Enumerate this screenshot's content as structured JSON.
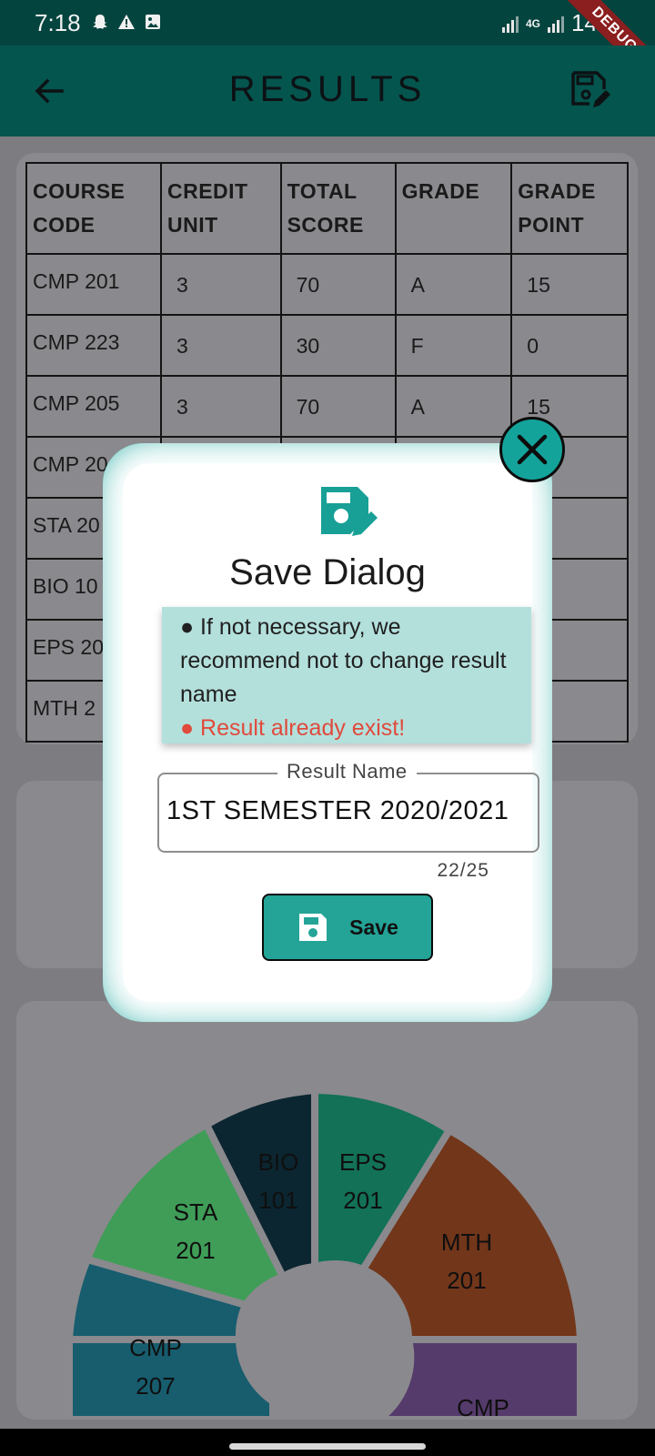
{
  "status_bar": {
    "time": "7:18",
    "network": "4G",
    "battery": "14%",
    "icons": [
      "snapchat-icon",
      "warning-icon",
      "image-icon"
    ]
  },
  "debug_banner": "DEBUG",
  "app_bar": {
    "title": "RESULTS",
    "back_icon": "arrow-left-icon",
    "action_icon": "save-edit-icon"
  },
  "table": {
    "headers": [
      [
        "COURSE",
        "CODE"
      ],
      [
        "CREDIT",
        "UNIT"
      ],
      [
        "TOTAL",
        "SCORE"
      ],
      [
        "GRADE",
        ""
      ],
      [
        "GRADE",
        "POINT"
      ]
    ],
    "rows": [
      [
        "CMP 201",
        "3",
        "70",
        "A",
        "15"
      ],
      [
        "CMP 223",
        "3",
        "30",
        "F",
        "0"
      ],
      [
        "CMP 205",
        "3",
        "70",
        "A",
        "15"
      ],
      [
        "CMP 20",
        "",
        "",
        "",
        ""
      ],
      [
        "STA 20",
        "",
        "",
        "",
        ""
      ],
      [
        "BIO 10",
        "",
        "",
        "",
        ""
      ],
      [
        "EPS 20",
        "",
        "",
        "",
        ""
      ],
      [
        "MTH 2",
        "",
        "",
        "",
        ""
      ]
    ]
  },
  "pie": {
    "slices": [
      {
        "line1": "BIO",
        "line2": "101",
        "color": "#0b2631"
      },
      {
        "line1": "EPS",
        "line2": "201",
        "color": "#127157"
      },
      {
        "line1": "MTH",
        "line2": "201",
        "color": "#72361a"
      },
      {
        "line1": "STA",
        "line2": "201",
        "color": "#3f9d57"
      },
      {
        "line1": "CMP",
        "line2": "207",
        "color": "#175d6e"
      },
      {
        "line1": "CMP",
        "line2": "",
        "color": "#553b6b"
      }
    ]
  },
  "dialog": {
    "title": "Save Dialog",
    "notice_line1": "● If not necessary, we recommend not to change result name",
    "notice_error": "● Result already exist!",
    "field_label": "Result Name",
    "field_value": "1ST SEMESTER 2020/2021",
    "counter": "22/25",
    "save_label": "Save",
    "accent": "#11a39a"
  }
}
